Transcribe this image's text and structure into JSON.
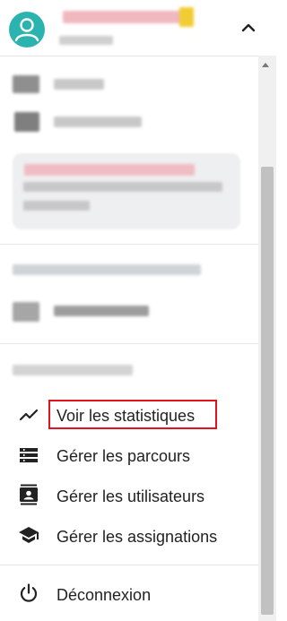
{
  "menu": {
    "items": [
      {
        "label": "Voir les statistiques",
        "icon": "trending-up-icon"
      },
      {
        "label": "Gérer les parcours",
        "icon": "list-icon"
      },
      {
        "label": "Gérer les utilisateurs",
        "icon": "contacts-icon"
      },
      {
        "label": "Gérer les assignations",
        "icon": "graduation-cap-icon"
      }
    ],
    "logout": {
      "label": "Déconnexion",
      "icon": "power-icon"
    }
  },
  "colors": {
    "avatar": "#2bb3b0",
    "highlight_border": "#e0131f",
    "text": "#222222"
  }
}
